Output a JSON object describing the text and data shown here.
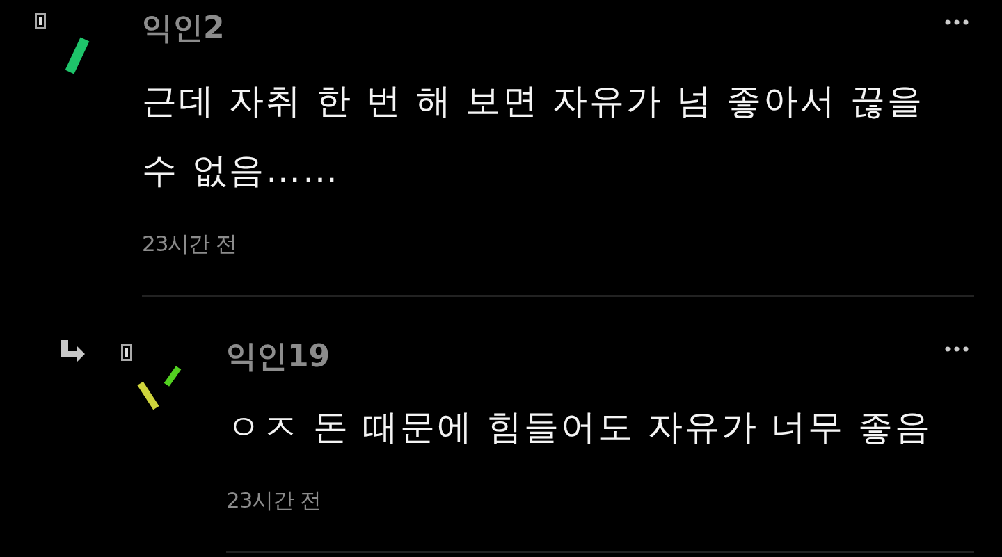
{
  "comments": [
    {
      "author": "익인2",
      "body": "근데 자취 한 번 해 보면 자유가 넘 좋아서 끊을 수 없음……",
      "time": "23시간 전",
      "reply": false
    },
    {
      "author": "익인19",
      "body": "ㅇㅈ 돈 때문에 힘들어도 자유가 너무 좋음",
      "time": "23시간 전",
      "reply": true
    }
  ]
}
